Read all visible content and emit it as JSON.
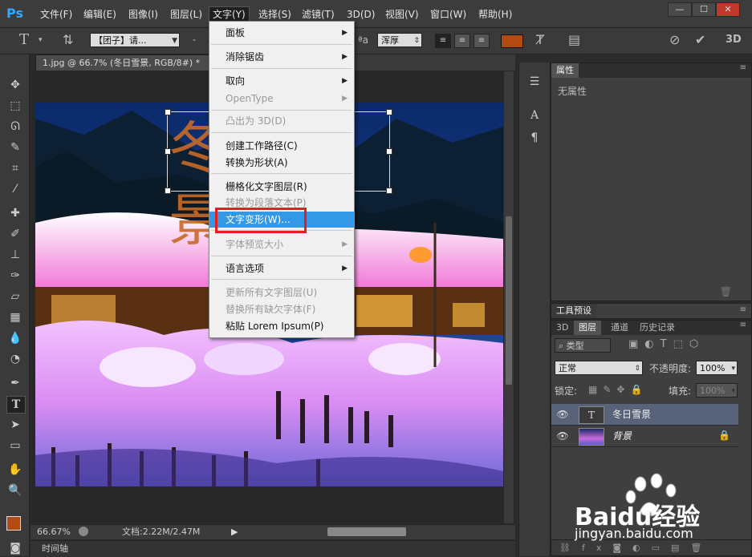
{
  "app": {
    "logo": "Ps"
  },
  "menubar": {
    "items": [
      "文件(F)",
      "编辑(E)",
      "图像(I)",
      "图层(L)",
      "文字(Y)",
      "选择(S)",
      "滤镜(T)",
      "3D(D)",
      "视图(V)",
      "窗口(W)",
      "帮助(H)"
    ],
    "active_index": 4,
    "window_controls": [
      "—",
      "☐",
      "✕"
    ]
  },
  "options_bar": {
    "font_family": "【团子】请...",
    "font_size_value": "-",
    "antialias": "浑厚",
    "text_color": "#b34a14",
    "three_d_label": "3D"
  },
  "document": {
    "tab_title": "1.jpg @ 66.7% (冬日雪景, RGB/8#) *",
    "tab_close": "×",
    "canvas_text": "冬日雪景",
    "zoom": "66.67%",
    "doc_info": "文档:2.22M/2.47M",
    "timeline_label": "时间轴"
  },
  "text_menu": {
    "items": [
      {
        "label": "面板",
        "submenu": true,
        "disabled": false
      },
      {
        "label": "消除锯齿",
        "submenu": true,
        "disabled": false
      },
      {
        "label": "取向",
        "submenu": true,
        "disabled": false
      },
      {
        "label": "OpenType",
        "submenu": true,
        "disabled": true
      },
      {
        "label": "凸出为 3D(D)",
        "submenu": false,
        "disabled": true
      },
      {
        "label": "创建工作路径(C)",
        "submenu": false,
        "disabled": false
      },
      {
        "label": "转换为形状(A)",
        "submenu": false,
        "disabled": false
      },
      {
        "label": "栅格化文字图层(R)",
        "submenu": false,
        "disabled": false
      },
      {
        "label": "转换为段落文本(P)",
        "submenu": false,
        "disabled": true
      },
      {
        "label": "文字变形(W)...",
        "submenu": false,
        "disabled": false,
        "highlight": true
      },
      {
        "label": "字体预览大小",
        "submenu": true,
        "disabled": true
      },
      {
        "label": "语言选项",
        "submenu": true,
        "disabled": false
      },
      {
        "label": "更新所有文字图层(U)",
        "submenu": false,
        "disabled": true
      },
      {
        "label": "替换所有缺欠字体(F)",
        "submenu": false,
        "disabled": true
      },
      {
        "label": "粘贴 Lorem Ipsum(P)",
        "submenu": false,
        "disabled": false
      }
    ]
  },
  "properties_panel": {
    "tab": "属性",
    "content": "无属性"
  },
  "tool_presets_panel": {
    "tab": "工具预设"
  },
  "layers_panel": {
    "tabs": [
      "3D",
      "图层",
      "通道",
      "历史记录"
    ],
    "active_tab": "图层",
    "filter_kind": "类型",
    "blend_mode": "正常",
    "opacity_label": "不透明度:",
    "opacity_value": "100%",
    "lock_label": "锁定:",
    "fill_label": "填充:",
    "fill_value": "100%",
    "layers": [
      {
        "name": "冬日雪景",
        "type": "text",
        "selected": true
      },
      {
        "name": "背景",
        "type": "image",
        "selected": false,
        "locked": true
      }
    ]
  },
  "watermark": {
    "brand": "Baidu经验",
    "url": "jingyan.baidu.com"
  }
}
